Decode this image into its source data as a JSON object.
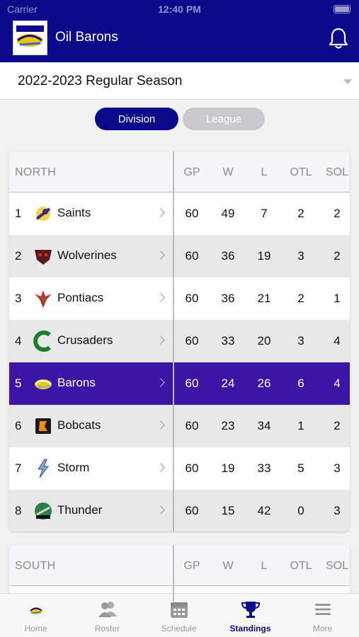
{
  "status_bar": {
    "carrier": "Carrier",
    "time": "12:40 PM"
  },
  "app": {
    "title": "Oil Barons"
  },
  "season": {
    "label": "2022-2023 Regular Season"
  },
  "segments": {
    "division": "Division",
    "league": "League"
  },
  "columns": {
    "gp": "GP",
    "w": "W",
    "l": "L",
    "otl": "OTL",
    "sol": "SOL"
  },
  "north": {
    "name": "NORTH",
    "rows": [
      {
        "rank": "1",
        "team": "Saints",
        "gp": "60",
        "w": "49",
        "l": "7",
        "otl": "2",
        "sol": "2"
      },
      {
        "rank": "2",
        "team": "Wolverines",
        "gp": "60",
        "w": "36",
        "l": "19",
        "otl": "3",
        "sol": "2"
      },
      {
        "rank": "3",
        "team": "Pontiacs",
        "gp": "60",
        "w": "36",
        "l": "21",
        "otl": "2",
        "sol": "1"
      },
      {
        "rank": "4",
        "team": "Crusaders",
        "gp": "60",
        "w": "33",
        "l": "20",
        "otl": "3",
        "sol": "4"
      },
      {
        "rank": "5",
        "team": "Barons",
        "gp": "60",
        "w": "24",
        "l": "26",
        "otl": "6",
        "sol": "4"
      },
      {
        "rank": "6",
        "team": "Bobcats",
        "gp": "60",
        "w": "23",
        "l": "34",
        "otl": "1",
        "sol": "2"
      },
      {
        "rank": "7",
        "team": "Storm",
        "gp": "60",
        "w": "19",
        "l": "33",
        "otl": "5",
        "sol": "3"
      },
      {
        "rank": "8",
        "team": "Thunder",
        "gp": "60",
        "w": "15",
        "l": "42",
        "otl": "0",
        "sol": "3"
      }
    ]
  },
  "south": {
    "name": "SOUTH"
  },
  "tabs": [
    {
      "label": "Home",
      "icon": "home-logo-icon"
    },
    {
      "label": "Roster",
      "icon": "people-icon"
    },
    {
      "label": "Schedule",
      "icon": "calendar-icon"
    },
    {
      "label": "Standings",
      "icon": "trophy-icon"
    },
    {
      "label": "More",
      "icon": "menu-icon"
    }
  ],
  "colors": {
    "primary": "#0c0a8a",
    "highlight_row": "#3b16a5",
    "inactive_segment": "#c9c9cb"
  }
}
